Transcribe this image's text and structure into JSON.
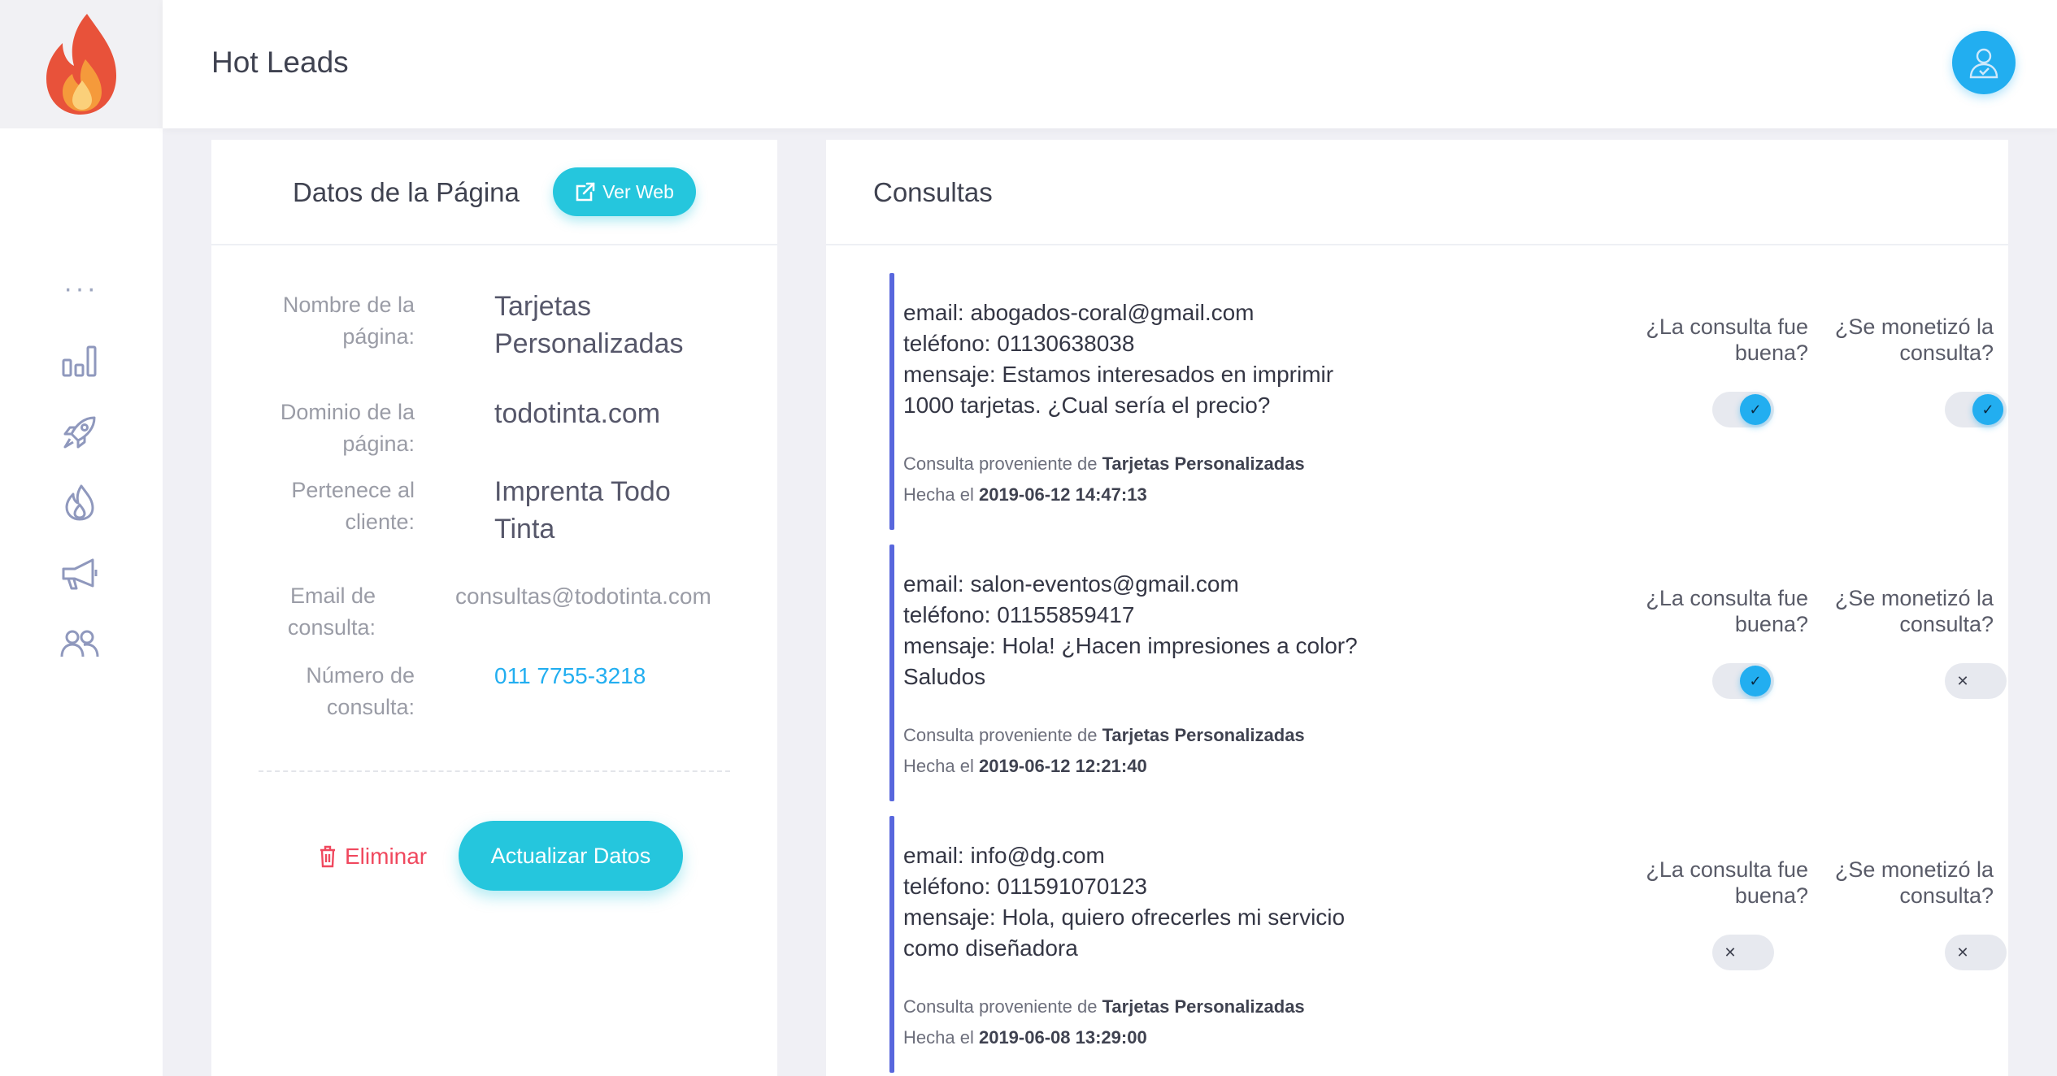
{
  "header": {
    "title": "Hot Leads"
  },
  "sidebar": {
    "dots": "···",
    "items": [
      {
        "icon": "bar-chart-icon"
      },
      {
        "icon": "rocket-icon"
      },
      {
        "icon": "flame-icon"
      },
      {
        "icon": "megaphone-icon"
      },
      {
        "icon": "users-icon"
      }
    ]
  },
  "page_data_card": {
    "title": "Datos de la Página",
    "ver_web_label": "Ver Web",
    "fields": [
      {
        "label": "Nombre de la página:",
        "value": "Tarjetas Personalizadas"
      },
      {
        "label": "Dominio de la página:",
        "value": "todotinta.com"
      },
      {
        "label": "Pertenece al cliente:",
        "value": "Imprenta Todo Tinta"
      },
      {
        "label": "Email de consulta:",
        "value": "consultas@todotinta.com"
      },
      {
        "label": "Número de consulta:",
        "value": "011 7755-3218"
      }
    ],
    "delete_label": "Eliminar",
    "update_label": "Actualizar Datos"
  },
  "consultas": {
    "title": "Consultas",
    "question_good": "¿La consulta fue buena?",
    "question_monetized": "¿Se monetizó la consulta?",
    "origin_prefix": "Consulta proveniente de",
    "date_prefix": "Hecha el",
    "items": [
      {
        "email": "email: abogados-coral@gmail.com",
        "phone": "teléfono: 01130638038",
        "message_l1": "mensaje: Estamos interesados en imprimir",
        "message_l2": "1000 tarjetas. ¿Cual sería el precio?",
        "origin": "Tarjetas Personalizadas",
        "date": "2019-06-12 14:47:13",
        "good": true,
        "monetized": true
      },
      {
        "email": "email: salon-eventos@gmail.com",
        "phone": "teléfono: 01155859417",
        "message_l1": "mensaje: Hola! ¿Hacen impresiones a color?",
        "message_l2": "Saludos",
        "origin": "Tarjetas Personalizadas",
        "date": "2019-06-12 12:21:40",
        "good": true,
        "monetized": false
      },
      {
        "email": "email: info@dg.com",
        "phone": "teléfono: 011591070123",
        "message_l1": "mensaje: Hola, quiero ofrecerles mi servicio",
        "message_l2": "como diseñadora",
        "origin": "Tarjetas Personalizadas",
        "date": "2019-06-08 13:29:00",
        "good": false,
        "monetized": false
      }
    ]
  },
  "colors": {
    "accent": "#25c6dd",
    "avatar": "#22aef0",
    "link": "#22aef0",
    "danger": "#f0485e",
    "consulta_bar": "#5867dd"
  },
  "icons": {
    "check": "✓",
    "cross": "✕"
  }
}
